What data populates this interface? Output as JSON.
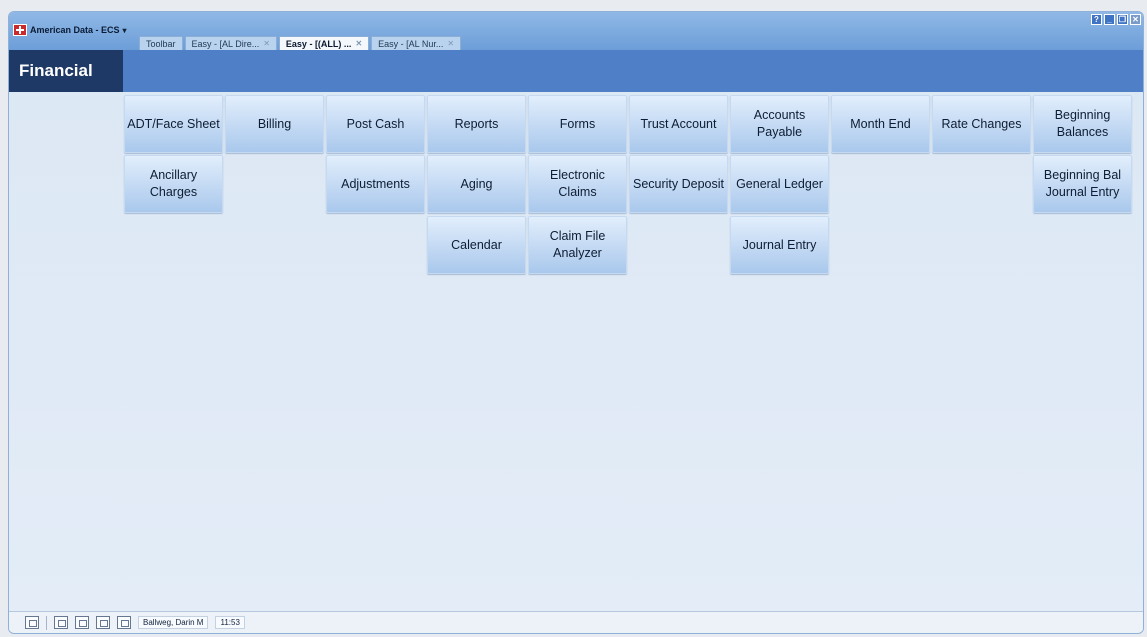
{
  "app": {
    "title": "American Data - ECS"
  },
  "tabs": [
    {
      "label": "Toolbar",
      "active": false
    },
    {
      "label": "Easy - [AL Dire...",
      "active": false
    },
    {
      "label": "Easy - [(ALL) ...",
      "active": true
    },
    {
      "label": "Easy - [AL Nur...",
      "active": false
    }
  ],
  "window_controls": [
    "help-icon",
    "minimize-icon",
    "restore-icon",
    "close-icon"
  ],
  "module": {
    "title": "Financial"
  },
  "tiles": {
    "adt_face_sheet": "ADT/Face Sheet",
    "billing": "Billing",
    "post_cash": "Post Cash",
    "reports": "Reports",
    "forms": "Forms",
    "trust_account": "Trust Account",
    "accounts_payable": "Accounts Payable",
    "month_end": "Month End",
    "rate_changes": "Rate Changes",
    "beginning_balances": "Beginning Balances",
    "ancillary_charges": "Ancillary Charges",
    "adjustments": "Adjustments",
    "aging": "Aging",
    "electronic_claims": "Electronic Claims",
    "security_deposit": "Security Deposit",
    "general_ledger": "General Ledger",
    "beginning_bal_journal_entry": "Beginning Bal Journal Entry",
    "calendar": "Calendar",
    "claim_file_analyzer": "Claim File Analyzer",
    "journal_entry": "Journal Entry"
  },
  "status": {
    "user": "Ballweg, Darin M",
    "time": "11:53"
  },
  "colors": {
    "header_blue": "#4f7fc6",
    "module_navy": "#1f3966",
    "tile_top": "#e2eefc",
    "tile_bottom": "#a9c8ec"
  }
}
